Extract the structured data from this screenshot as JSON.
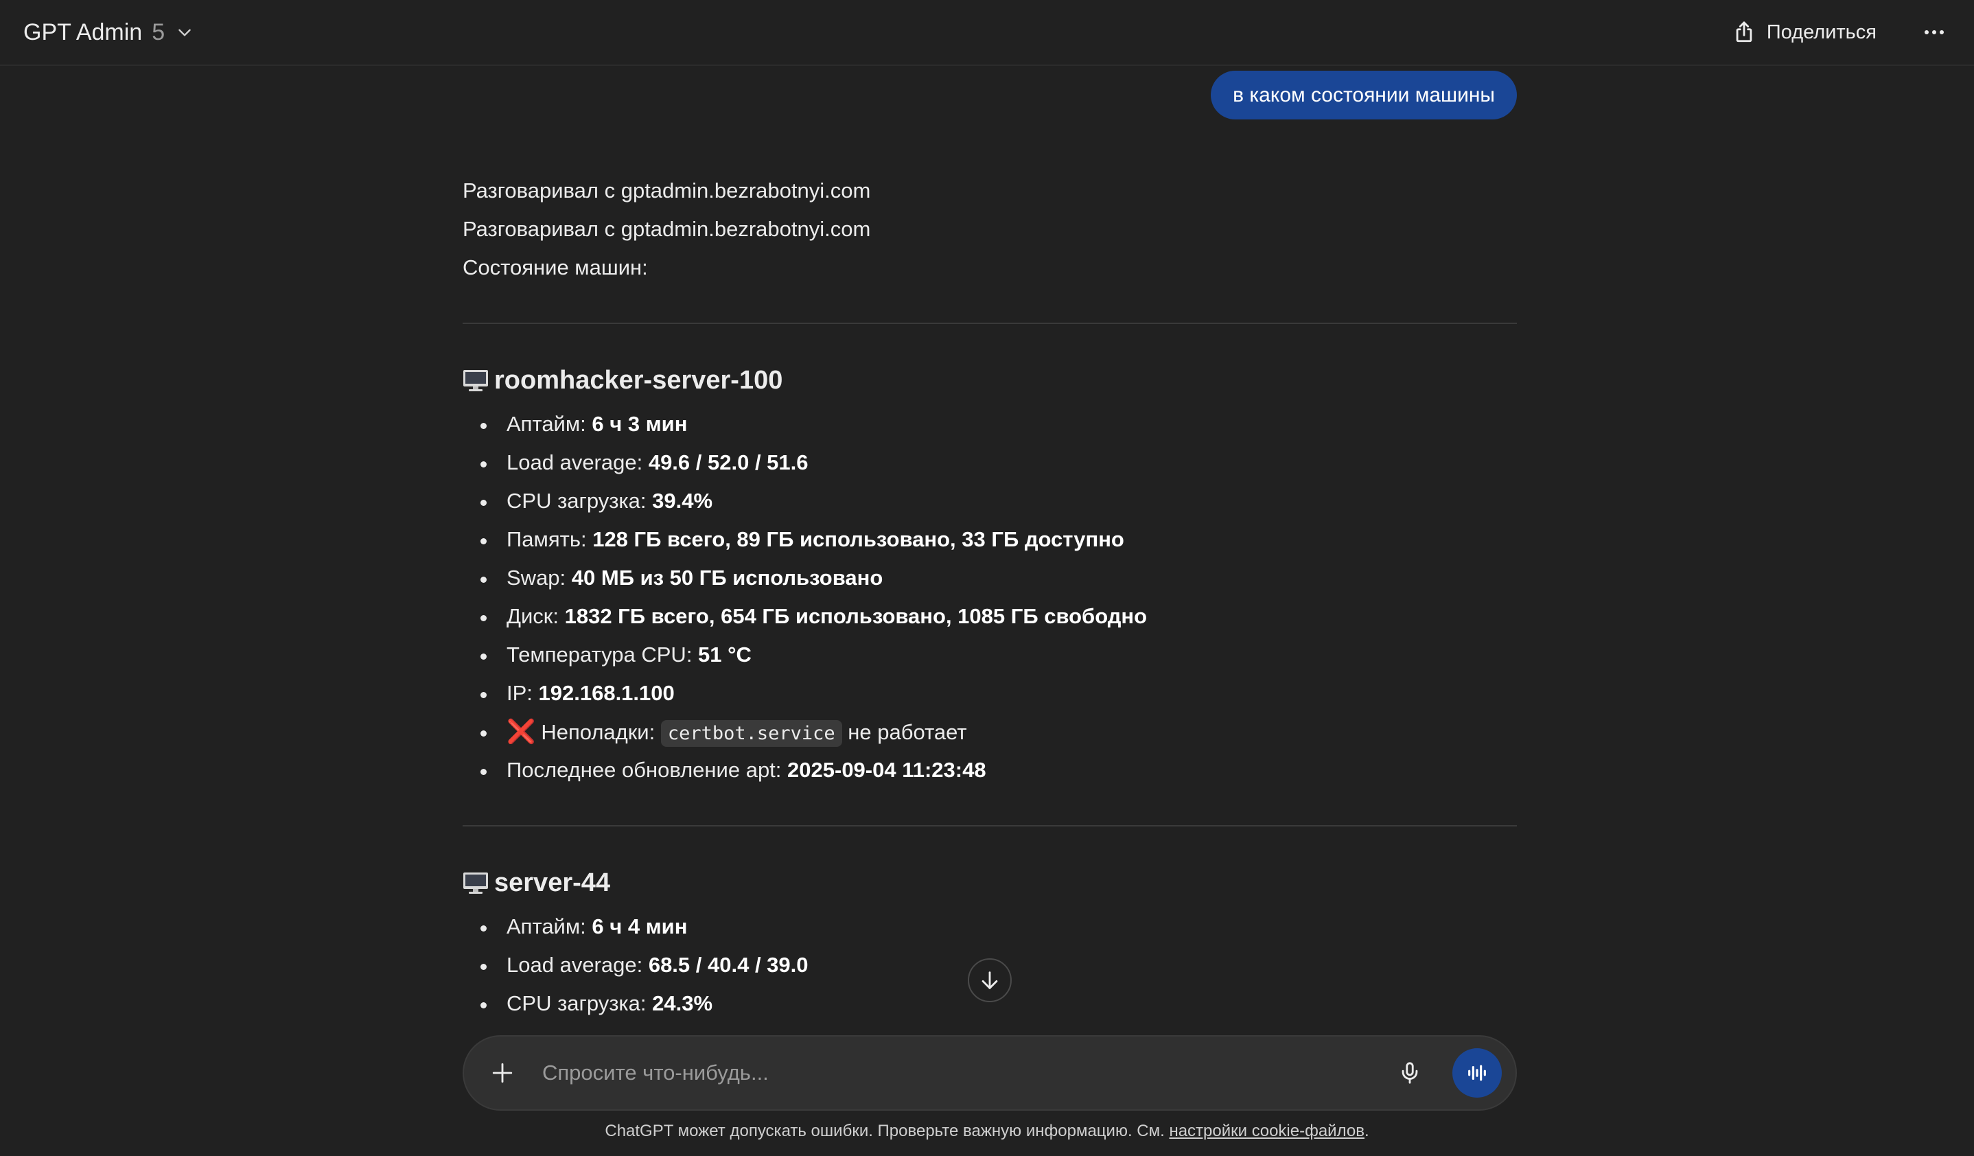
{
  "header": {
    "model_name": "GPT Admin",
    "model_version": "5",
    "share_label": "Поделиться"
  },
  "user_message": "в каком состоянии машины",
  "assistant": {
    "intro_lines": [
      "Разговаривал с gptadmin.bezrabotnyi.com",
      "Разговаривал с gptadmin.bezrabotnyi.com",
      "Состояние машин:"
    ],
    "servers": [
      {
        "name": "roomhacker-server-100",
        "stats": [
          {
            "label": "Аптайм: ",
            "value": "6 ч 3 мин"
          },
          {
            "label": "Load average: ",
            "value": "49.6 / 52.0 / 51.6"
          },
          {
            "label": "CPU загрузка: ",
            "value": "39.4%"
          },
          {
            "label": "Память: ",
            "value": "128 ГБ всего, 89 ГБ использовано, 33 ГБ доступно"
          },
          {
            "label": "Swap: ",
            "value": "40 МБ из 50 ГБ использовано"
          },
          {
            "label": "Диск: ",
            "value": "1832 ГБ всего, 654 ГБ использовано, 1085 ГБ свободно"
          },
          {
            "label": "Температура CPU: ",
            "value": "51 °C"
          },
          {
            "label": "IP: ",
            "value": "192.168.1.100"
          }
        ],
        "issue": {
          "icon": "❌",
          "label": "Неполадки: ",
          "code": "certbot.service",
          "suffix": " не работает"
        },
        "last_update": {
          "label": "Последнее обновление apt: ",
          "value": "2025-09-04 11:23:48"
        }
      },
      {
        "name": "server-44",
        "stats": [
          {
            "label": "Аптайм: ",
            "value": "6 ч 4 мин"
          },
          {
            "label": "Load average: ",
            "value": "68.5 / 40.4 / 39.0"
          },
          {
            "label": "CPU загрузка: ",
            "value": "24.3%"
          }
        ]
      }
    ]
  },
  "composer": {
    "placeholder": "Спросите что-нибудь..."
  },
  "footer": {
    "disclaimer_text": "ChatGPT может допускать ошибки. Проверьте важную информацию. См. ",
    "link_text": "настройки cookie-файлов",
    "end": "."
  },
  "colors": {
    "background": "#212121",
    "user_bubble": "#1a4696",
    "voice_button": "#1a4696",
    "error": "#e53935"
  },
  "icons": {
    "share": "share-upload-icon",
    "more": "more-horizontal-icon",
    "server": "monitor-icon",
    "scroll": "arrow-down-icon",
    "plus": "plus-icon",
    "mic": "microphone-icon",
    "voice": "voice-waveform-icon"
  }
}
